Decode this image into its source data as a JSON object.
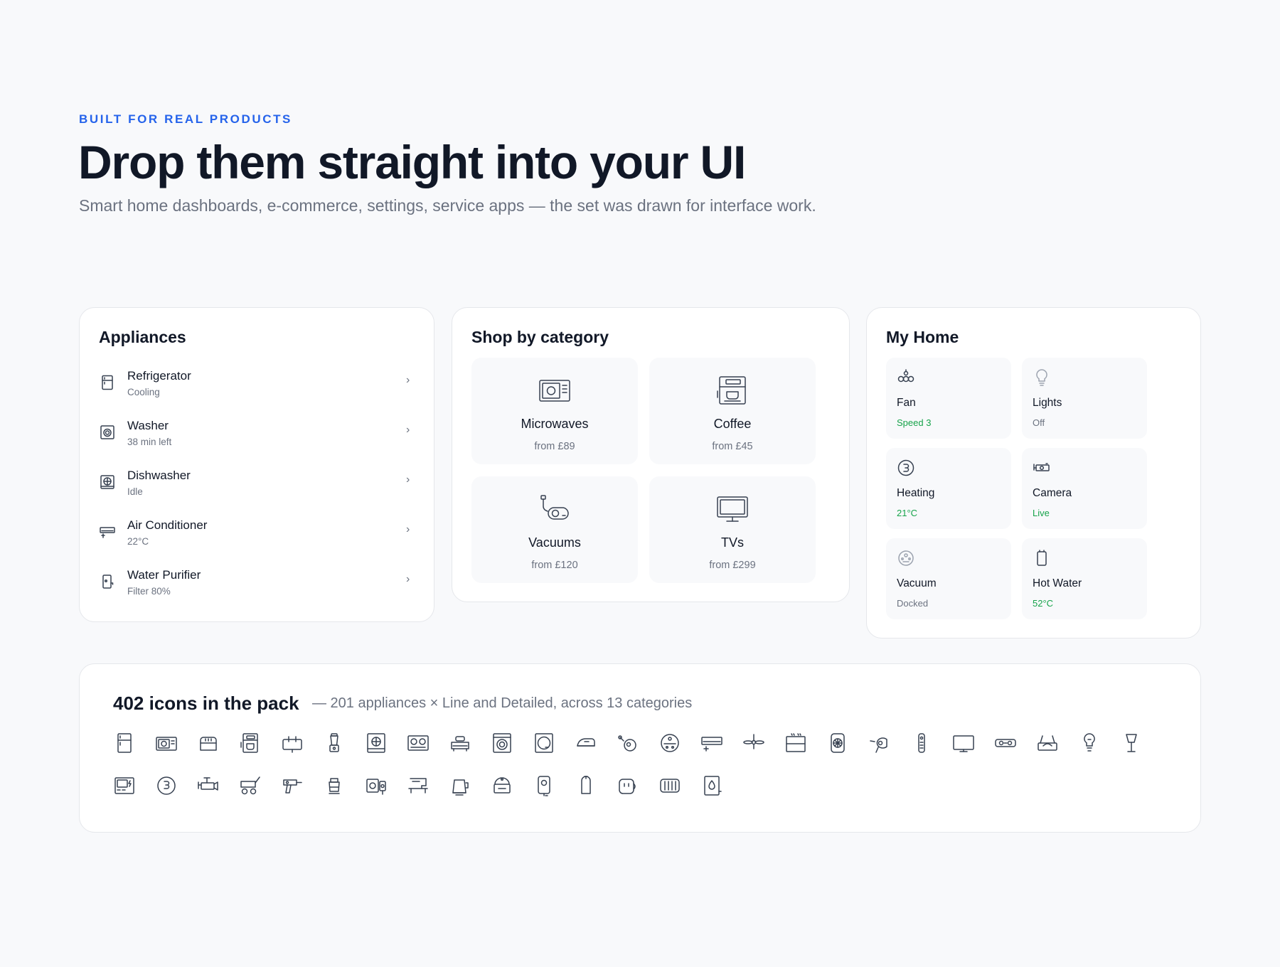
{
  "hero": {
    "eyebrow": "BUILT FOR REAL PRODUCTS",
    "title": "Drop them straight into your UI",
    "subtitle": "Smart home dashboards, e-commerce, settings, service apps — the set was drawn for interface work."
  },
  "appliances": {
    "title": "Appliances",
    "items": [
      {
        "name": "Refrigerator",
        "status": "Cooling",
        "icon": "refrigerator-icon"
      },
      {
        "name": "Washer",
        "status": "38 min left",
        "icon": "washer-icon"
      },
      {
        "name": "Dishwasher",
        "status": "Idle",
        "icon": "dishwasher-icon"
      },
      {
        "name": "Air Conditioner",
        "status": "22°C",
        "icon": "air-conditioner-icon"
      },
      {
        "name": "Water Purifier",
        "status": "Filter 80%",
        "icon": "water-purifier-icon"
      }
    ],
    "chevron": "›"
  },
  "shop": {
    "title": "Shop by category",
    "tiles": [
      {
        "name": "Microwaves",
        "price": "from £89",
        "icon": "microwave-icon"
      },
      {
        "name": "Coffee",
        "price": "from £45",
        "icon": "coffee-machine-icon"
      },
      {
        "name": "Vacuums",
        "price": "from £120",
        "icon": "vacuum-icon"
      },
      {
        "name": "TVs",
        "price": "from £299",
        "icon": "tv-icon"
      }
    ]
  },
  "home": {
    "title": "My Home",
    "devices": [
      {
        "name": "Fan",
        "status": "Speed 3",
        "active": true,
        "icon": "fan-icon"
      },
      {
        "name": "Lights",
        "status": "Off",
        "active": false,
        "icon": "bulb-icon"
      },
      {
        "name": "Heating",
        "status": "21°C",
        "active": true,
        "icon": "heating-icon"
      },
      {
        "name": "Camera",
        "status": "Live",
        "active": true,
        "icon": "camera-icon"
      },
      {
        "name": "Vacuum",
        "status": "Docked",
        "active": false,
        "icon": "robot-vacuum-icon"
      },
      {
        "name": "Hot Water",
        "status": "52°C",
        "active": true,
        "icon": "water-heater-icon"
      }
    ],
    "colors": {
      "active": "#16a34a",
      "inactive": "#6b7280"
    }
  },
  "pack": {
    "title": "402 icons in the pack",
    "subtitle": "— 201 appliances × Line and Detailed, across 13 categories",
    "icon_rows": [
      [
        "fridge-icon",
        "microwave-icon",
        "toaster-icon",
        "coffee-machine-icon",
        "sandwich-maker-icon",
        "blender-icon",
        "oven-icon",
        "cooktop-icon",
        "rice-cooker-icon",
        "washing-machine-icon",
        "dryer-icon",
        "iron-icon",
        "vacuum-icon",
        "robot-vacuum-icon",
        "air-conditioner-icon",
        "ceiling-fan-icon",
        "range-hood-icon",
        "fan-heater-icon",
        "hair-dryer-icon",
        "remote-icon",
        "tv-icon",
        "projector-icon",
        "router-icon",
        "light-bulb-icon",
        "lamp-icon"
      ],
      [
        "electric-panel-icon",
        "thermostat-icon",
        "security-camera-icon",
        "lawn-mower-icon",
        "drill-icon",
        "mixer-icon",
        "speaker-icon",
        "sewing-machine-icon",
        "kettle-icon",
        "slow-cooker-icon",
        "water-heater-icon",
        "gas-cylinder-icon",
        "smart-plug-icon",
        "radiator-icon",
        "humidifier-icon"
      ]
    ]
  }
}
